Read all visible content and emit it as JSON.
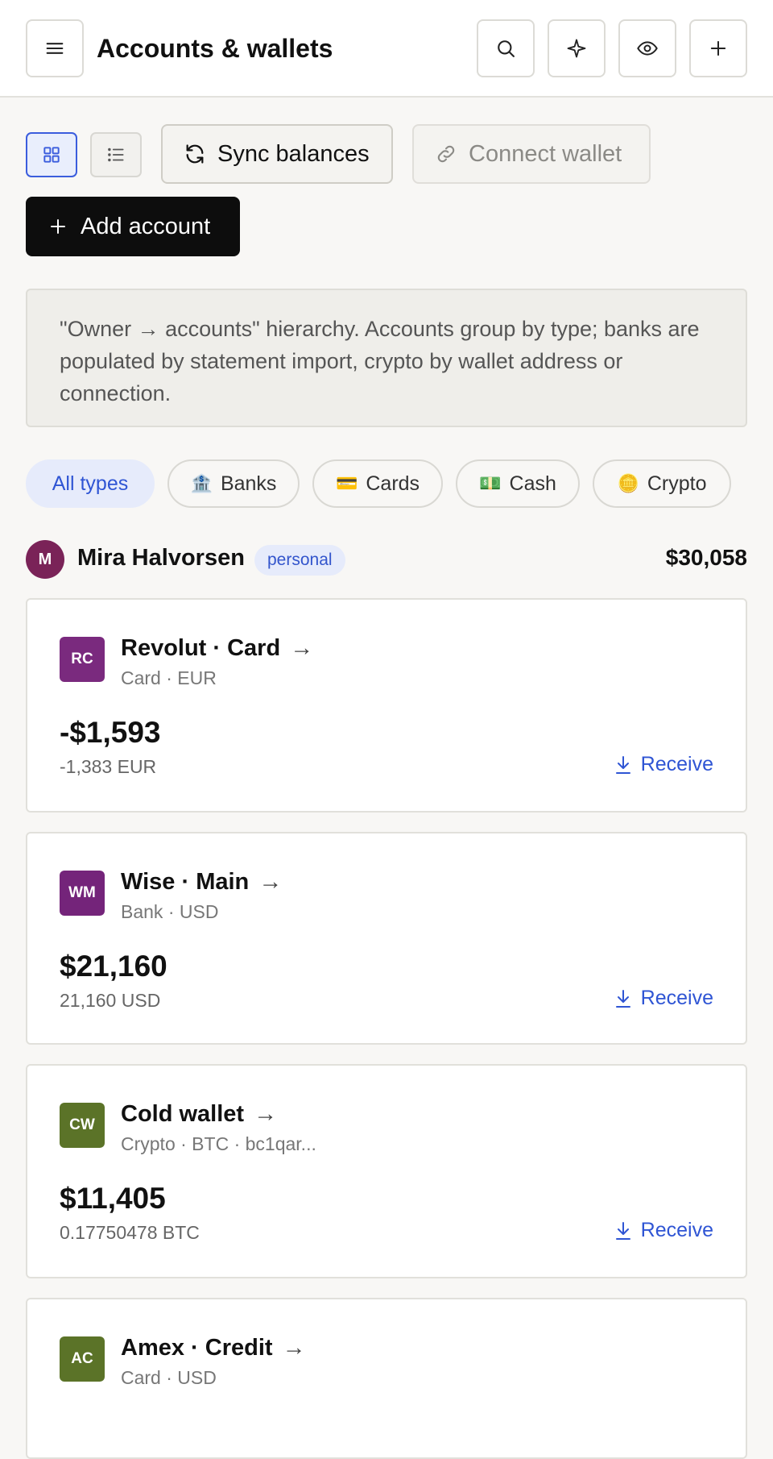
{
  "header": {
    "title": "Accounts & wallets",
    "icons": [
      "menu-icon",
      "search-icon",
      "sparkle-icon",
      "eye-icon",
      "plus-icon"
    ]
  },
  "toolbar": {
    "sync_label": "Sync balances",
    "connect_label": "Connect wallet",
    "add_label": "Add account",
    "view_mode": "grid"
  },
  "note": "\"Owner → accounts\" hierarchy. Accounts group by type; banks are populated by statement import, crypto by wallet address or connection.",
  "filters": [
    {
      "label": "All types",
      "glyph": "",
      "active": true
    },
    {
      "label": "Banks",
      "glyph": "🏦",
      "active": false
    },
    {
      "label": "Cards",
      "glyph": "💳",
      "active": false
    },
    {
      "label": "Cash",
      "glyph": "💵",
      "active": false
    },
    {
      "label": "Crypto",
      "glyph": "🪙",
      "active": false
    }
  ],
  "owner": {
    "initial": "M",
    "name": "Mira Halvorsen",
    "badge": "personal",
    "total": "$30,058",
    "avatar_color": "#7a2358"
  },
  "accounts": [
    {
      "initials": "RC",
      "name": "Revolut · Card",
      "arrow": "→",
      "sub": "Card · EUR",
      "amount": "-$1,593",
      "native": "-1,383 EUR",
      "action": "Receive",
      "color": "#7a2a7e"
    },
    {
      "initials": "WM",
      "name": "Wise · Main",
      "arrow": "→",
      "sub": "Bank · USD",
      "amount": "$21,160",
      "native": "21,160 USD",
      "action": "Receive",
      "color": "#74247a"
    },
    {
      "initials": "CW",
      "name": "Cold wallet",
      "arrow": "→",
      "sub": "Crypto · BTC · bc1qar...",
      "amount": "$11,405",
      "native": "0.17750478 BTC",
      "action": "Receive",
      "color": "#5b7328"
    },
    {
      "initials": "AC",
      "name": "Amex · Credit",
      "arrow": "→",
      "sub": "Card · USD",
      "amount": "",
      "native": "",
      "action": "",
      "color": "#5b7328"
    }
  ]
}
